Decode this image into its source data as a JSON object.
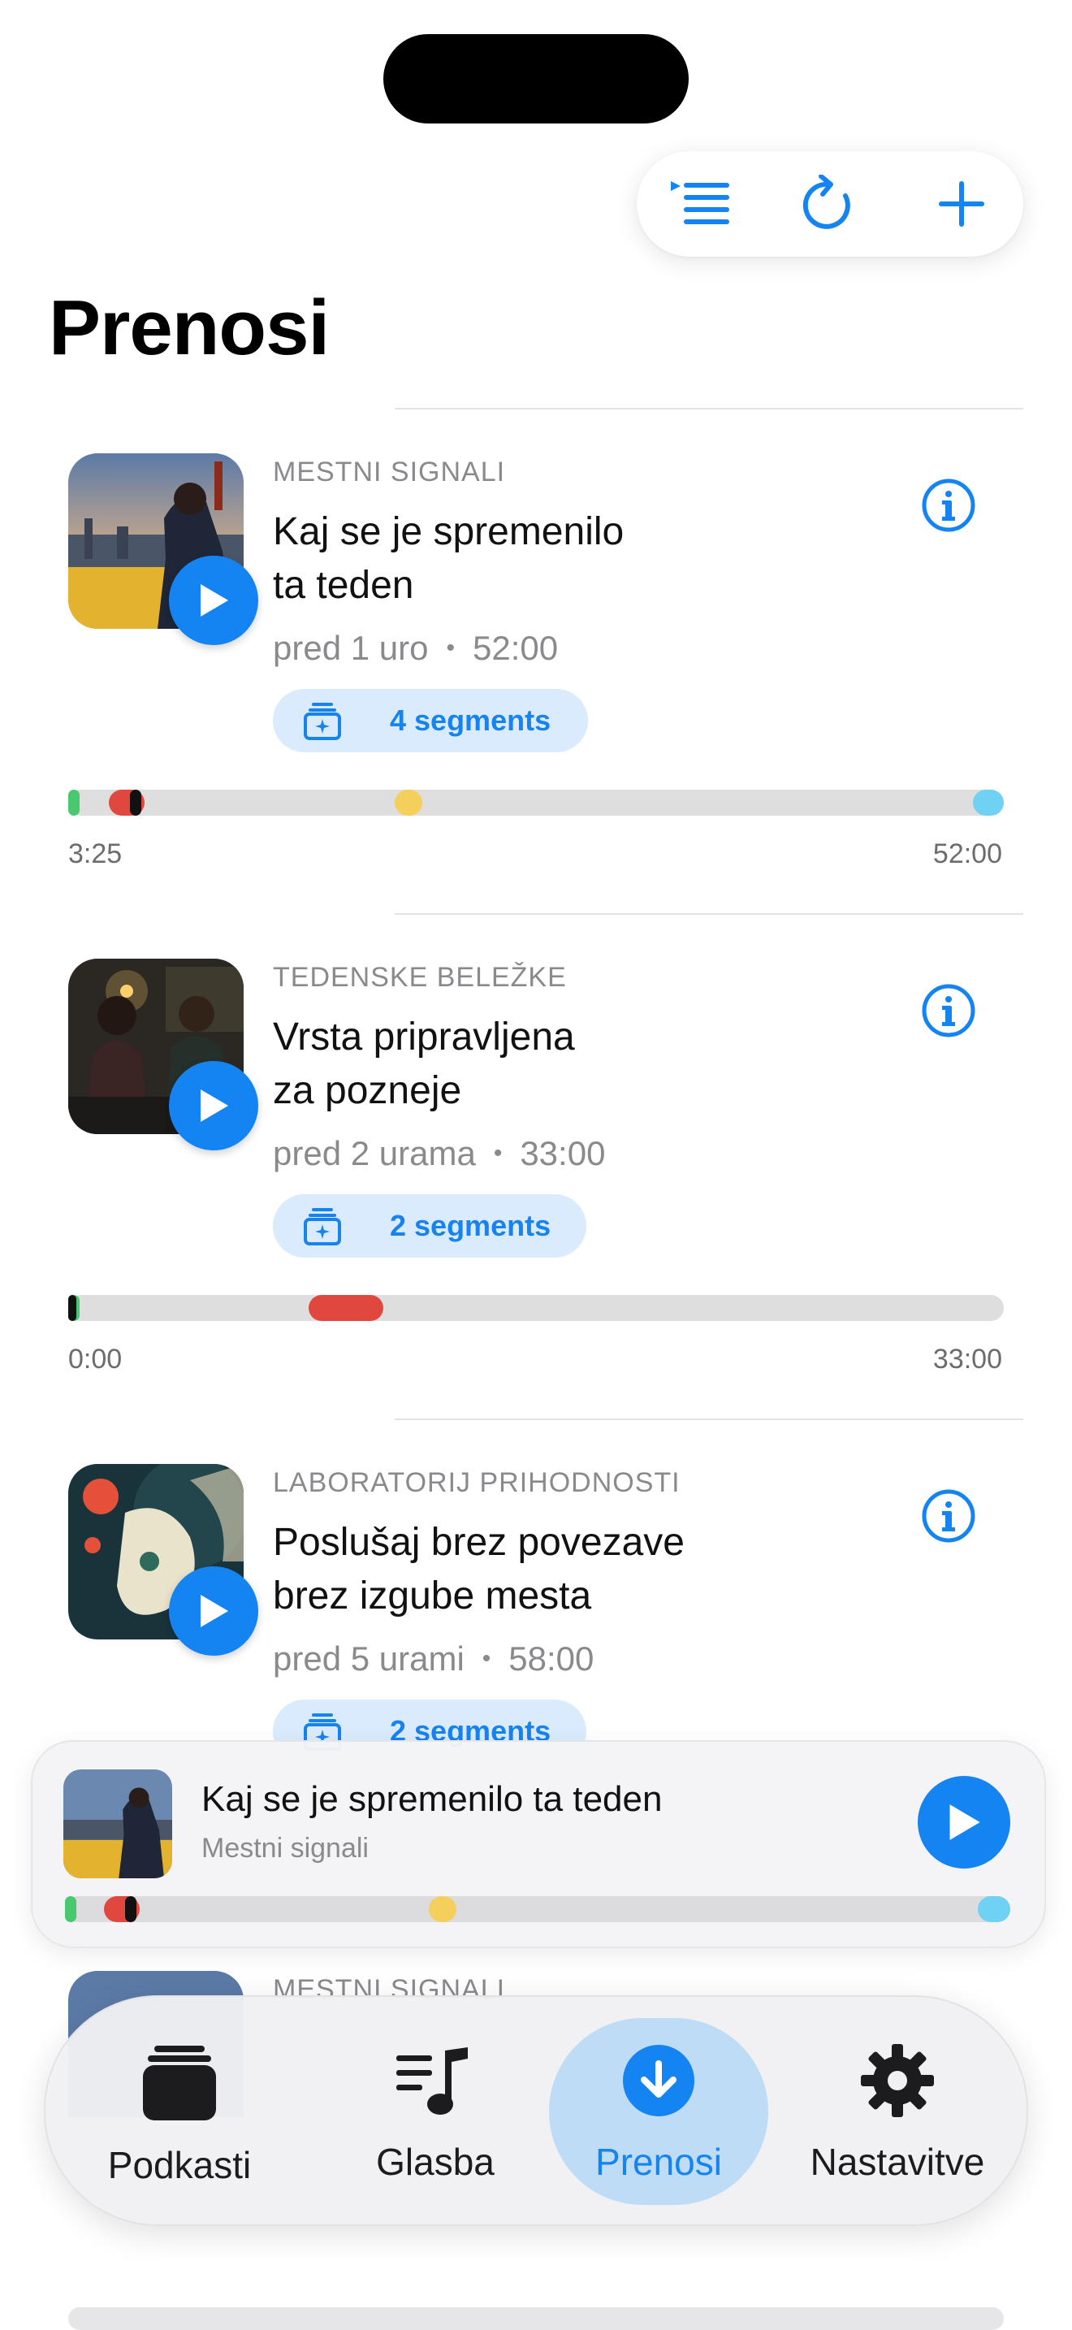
{
  "toolbar": {
    "queue_icon": "queue-list-icon",
    "refresh_icon": "refresh-icon",
    "add_icon": "plus-icon"
  },
  "page_title": "Prenosi",
  "accent_color": "#1584f3",
  "episodes": [
    {
      "show": "MESTNI SIGNALI",
      "title_line1": "Kaj se je spremenilo",
      "title_line2": "ta teden",
      "age": "pred 1 uro",
      "duration": "52:00",
      "segments_label": "4 segments",
      "progress_current": "3:25",
      "progress_total": "52:00",
      "played_fraction": 0.066
    },
    {
      "show": "TEDENSKE BELEŽKE",
      "title_line1": "Vrsta pripravljena",
      "title_line2": "za pozneje",
      "age": "pred 2 urama",
      "duration": "33:00",
      "segments_label": "2 segments",
      "progress_current": "0:00",
      "progress_total": "33:00",
      "played_fraction": 0.0
    },
    {
      "show": "LABORATORIJ PRIHODNOSTI",
      "title_line1": "Poslušaj brez povezave",
      "title_line2": "brez izgube mesta",
      "age": "pred 5 urami",
      "duration": "58:00",
      "segments_label": "2 segments"
    },
    {
      "show": "MESTNI SIGNALI"
    }
  ],
  "mini_player": {
    "title": "Kaj se je spremenilo ta teden",
    "subtitle": "Mestni signali"
  },
  "tabs": [
    {
      "label": "Podkasti",
      "icon": "podcasts-stack-icon"
    },
    {
      "label": "Glasba",
      "icon": "music-list-icon"
    },
    {
      "label": "Prenosi",
      "icon": "download-icon",
      "active": true
    },
    {
      "label": "Nastavitve",
      "icon": "gear-icon"
    }
  ]
}
